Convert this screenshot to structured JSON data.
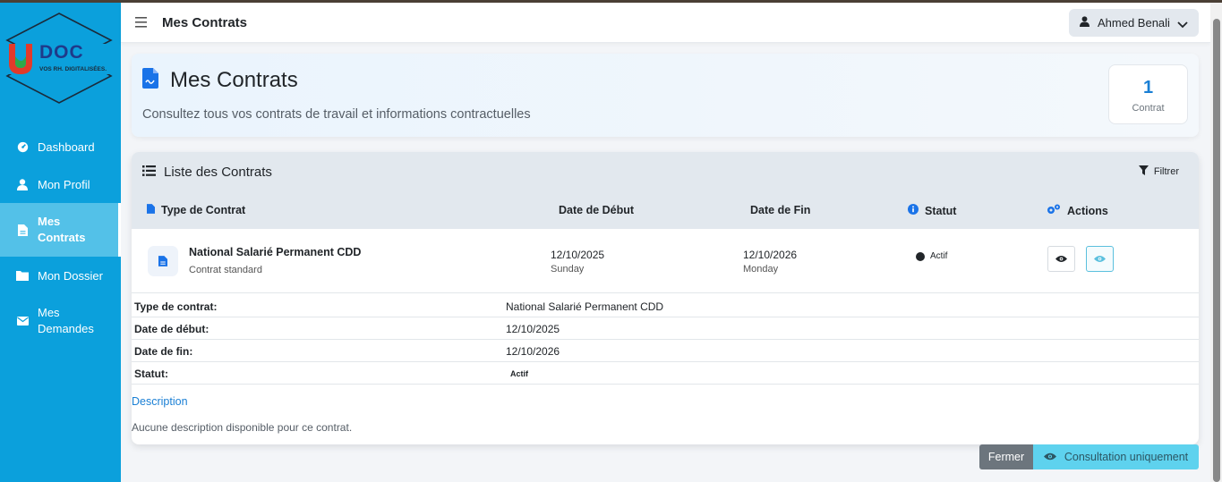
{
  "brand": {
    "logo_text": "DOC",
    "tagline": "VOS RH. DIGITALISÉES."
  },
  "sidebar": {
    "items": [
      {
        "label": "Dashboard",
        "icon": "gauge-icon"
      },
      {
        "label": "Mon Profil",
        "icon": "user-icon"
      },
      {
        "label": "Mes Contrats",
        "icon": "file-icon",
        "active": true
      },
      {
        "label": "Mon Dossier",
        "icon": "folder-icon"
      },
      {
        "label": "Mes Demandes",
        "icon": "envelope-icon"
      }
    ]
  },
  "topbar": {
    "title": "Mes Contrats",
    "user_name": "Ahmed Benali"
  },
  "header": {
    "title": "Mes Contrats",
    "subtitle": "Consultez tous vos contrats de travail et informations contractuelles",
    "count_value": "1",
    "count_label": "Contrat"
  },
  "list": {
    "title": "Liste des Contrats",
    "filter_label": "Filtrer",
    "columns": {
      "type": "Type de Contrat",
      "start": "Date de Début",
      "end": "Date de Fin",
      "status": "Statut",
      "actions": "Actions"
    },
    "rows": [
      {
        "name": "National Salarié Permanent CDD",
        "type": "Contrat standard",
        "start_date": "12/10/2025",
        "start_day": "Sunday",
        "end_date": "12/10/2026",
        "end_day": "Monday",
        "status": "Actif"
      }
    ]
  },
  "details": {
    "type_label": "Type de contrat:",
    "type_value": "National Salarié Permanent CDD",
    "start_label": "Date de début:",
    "start_value": "12/10/2025",
    "end_label": "Date de fin:",
    "end_value": "12/10/2026",
    "status_label": "Statut:",
    "status_value": "Actif",
    "description_title": "Description",
    "description_text": "Aucune description disponible pour ce contrat."
  },
  "footer": {
    "close_label": "Fermer",
    "consult_label": "Consultation uniquement"
  },
  "colors": {
    "sidebar": "#0ba0dc",
    "accent": "#1a7fd4",
    "info": "#5ed2ee"
  }
}
